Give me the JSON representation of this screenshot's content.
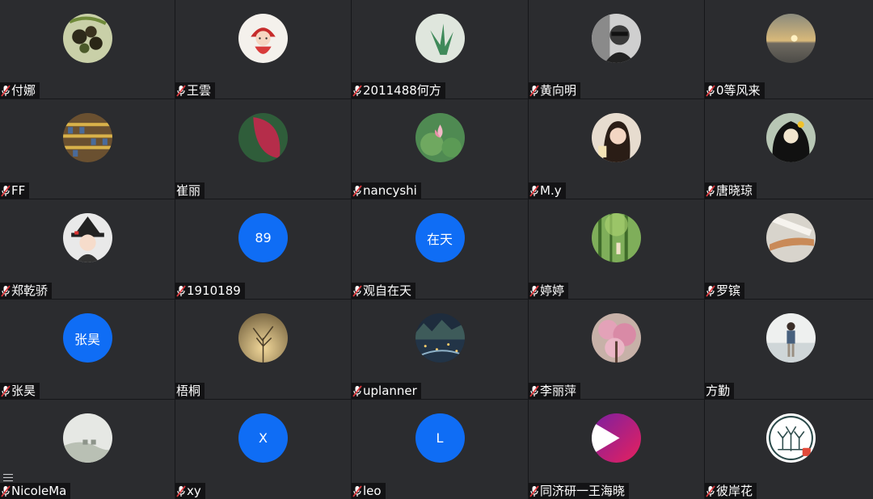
{
  "participants": [
    {
      "name": "付娜",
      "muted": true,
      "avatar": "photo",
      "avatar_desc": "berries-photo"
    },
    {
      "name": "王雲",
      "muted": true,
      "avatar": "photo",
      "avatar_desc": "cartoon-girl"
    },
    {
      "name": "2011488何方",
      "muted": true,
      "avatar": "photo",
      "avatar_desc": "succulent-photo"
    },
    {
      "name": "黄向明",
      "muted": true,
      "avatar": "photo",
      "avatar_desc": "portrait-bw"
    },
    {
      "name": "0等风来",
      "muted": true,
      "avatar": "photo",
      "avatar_desc": "sunset-photo"
    },
    {
      "name": "FF",
      "muted": true,
      "avatar": "photo",
      "avatar_desc": "shelves-photo"
    },
    {
      "name": "崔丽",
      "muted": false,
      "avatar": "photo",
      "avatar_desc": "red-leaf-photo"
    },
    {
      "name": "nancyshi",
      "muted": true,
      "avatar": "photo",
      "avatar_desc": "lotus-photo"
    },
    {
      "name": "M.y",
      "muted": true,
      "avatar": "photo",
      "avatar_desc": "girl-portrait"
    },
    {
      "name": "唐晓琼",
      "muted": true,
      "avatar": "photo",
      "avatar_desc": "illustrated-woman"
    },
    {
      "name": "郑乾骄",
      "muted": true,
      "avatar": "photo",
      "avatar_desc": "cartoon-witch"
    },
    {
      "name": "1910189",
      "muted": true,
      "avatar": "initials",
      "initials": "89"
    },
    {
      "name": "观自在天",
      "muted": true,
      "avatar": "initials",
      "initials": "在天"
    },
    {
      "name": "婷婷",
      "muted": true,
      "avatar": "photo",
      "avatar_desc": "forest-photo"
    },
    {
      "name": "罗镔",
      "muted": true,
      "avatar": "photo",
      "avatar_desc": "violin-photo"
    },
    {
      "name": "张昊",
      "muted": true,
      "avatar": "initials",
      "initials": "张昊"
    },
    {
      "name": "梧桐",
      "muted": false,
      "avatar": "photo",
      "avatar_desc": "misty-tree-photo"
    },
    {
      "name": "uplanner",
      "muted": true,
      "avatar": "photo",
      "avatar_desc": "night-city-photo"
    },
    {
      "name": "李丽萍",
      "muted": true,
      "avatar": "photo",
      "avatar_desc": "blossom-photo"
    },
    {
      "name": "方勤",
      "muted": false,
      "avatar": "photo",
      "avatar_desc": "person-standing-photo"
    },
    {
      "name": "NicoleMa",
      "muted": true,
      "avatar": "photo",
      "avatar_desc": "pale-landscape-photo"
    },
    {
      "name": "xy",
      "muted": true,
      "avatar": "initials",
      "initials": "X"
    },
    {
      "name": "leo",
      "muted": true,
      "avatar": "initials",
      "initials": "L"
    },
    {
      "name": "同济研一王海晓",
      "muted": true,
      "avatar": "logo",
      "avatar_desc": "play-logo"
    },
    {
      "name": "彼岸花",
      "muted": true,
      "avatar": "logo",
      "avatar_desc": "line-art-logo"
    }
  ],
  "colors": {
    "tile_bg": "#2b2c2f",
    "initials_bg": "#0f6df5",
    "muted_mic": "#e0393e"
  }
}
